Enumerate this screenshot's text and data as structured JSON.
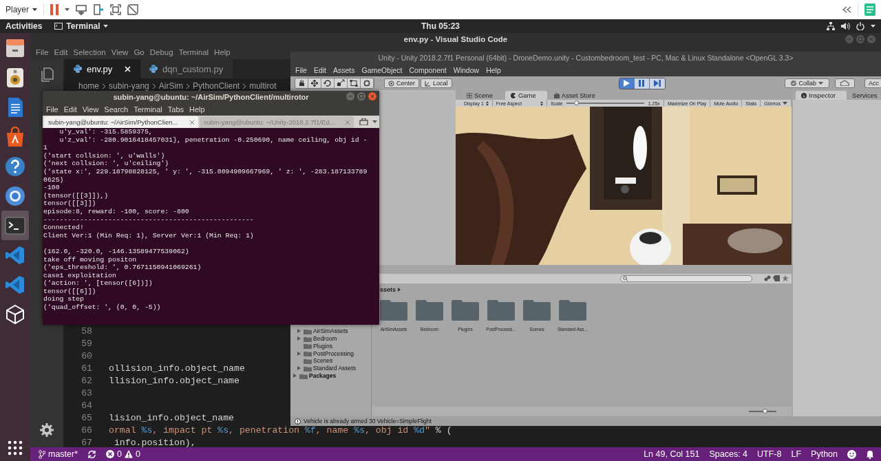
{
  "player_bar": {
    "menu": "Player"
  },
  "top_panel": {
    "activities": "Activities",
    "app_menu": "Terminal",
    "clock": "Thu 05:23"
  },
  "dock": [
    {
      "kind": "files",
      "active": false
    },
    {
      "kind": "music",
      "active": false
    },
    {
      "kind": "writer",
      "active": false
    },
    {
      "kind": "software",
      "active": false
    },
    {
      "kind": "help",
      "active": false
    },
    {
      "kind": "browser",
      "active": false
    },
    {
      "kind": "terminal",
      "active": true
    },
    {
      "kind": "code",
      "active": false
    },
    {
      "kind": "code",
      "active": false
    },
    {
      "kind": "unity",
      "active": false
    }
  ],
  "vscode": {
    "title": "env.py - Visual Studio Code",
    "menu": [
      "File",
      "Edit",
      "Selection",
      "View",
      "Go",
      "Debug",
      "Terminal",
      "Help"
    ],
    "tabs": [
      {
        "label": "env.py",
        "selected": true
      },
      {
        "label": "dqn_custom.py",
        "selected": false
      }
    ],
    "breadcrumb": [
      "home",
      "subin-yang",
      "AirSim",
      "PythonClient",
      "multirot"
    ],
    "code_lines": [
      {
        "number": "58"
      },
      {
        "number": "59"
      },
      {
        "number": "60"
      },
      {
        "number": "61",
        "tokens": [
          {
            "text": "ollision_info.object_name",
            "kind": "plain"
          }
        ]
      },
      {
        "number": "62",
        "tokens": [
          {
            "text": "llision_info.object_name",
            "kind": "plain"
          }
        ]
      },
      {
        "number": "63"
      },
      {
        "number": "64"
      },
      {
        "number": "65",
        "tokens": [
          {
            "text": "lision_info.object_name",
            "kind": "plain"
          }
        ]
      },
      {
        "number": "66",
        "tokens": [
          {
            "text": "ormal ",
            "kind": "string"
          },
          {
            "text": "%s",
            "kind": "format"
          },
          {
            "text": ", impact pt ",
            "kind": "string"
          },
          {
            "text": "%s",
            "kind": "format"
          },
          {
            "text": ", penetration ",
            "kind": "string"
          },
          {
            "text": "%f",
            "kind": "format"
          },
          {
            "text": ", name ",
            "kind": "string"
          },
          {
            "text": "%s",
            "kind": "format"
          },
          {
            "text": ", obj id ",
            "kind": "string"
          },
          {
            "text": "%d",
            "kind": "format"
          },
          {
            "text": "\"",
            "kind": "string"
          },
          {
            "text": " % (",
            "kind": "plain"
          }
        ]
      },
      {
        "number": "67",
        "tokens": [
          {
            "text": " info.position),",
            "kind": "plain"
          }
        ]
      }
    ],
    "status_bar": {
      "branch": "master*",
      "errors": "0",
      "warnings": "0",
      "position": "Ln 49, Col 151",
      "indent": "Spaces: 4",
      "encoding": "UTF-8",
      "eol": "LF",
      "language": "Python"
    }
  },
  "unity": {
    "title": "Unity - Unity 2018.2.7f1 Personal (64bit) - DroneDemo.unity - Custombedroom_test - PC, Mac & Linux Standalone <OpenGL 3.3>",
    "menu": [
      "File",
      "Edit",
      "Assets",
      "GameObject",
      "Component",
      "Window",
      "Help"
    ],
    "pivot": [
      "Center",
      "Local"
    ],
    "playing": true,
    "collab": "Collab",
    "account": "Acc",
    "view_tabs": [
      {
        "label": "Scene",
        "selected": false
      },
      {
        "label": "Game",
        "selected": true
      },
      {
        "label": "Asset Store",
        "selected": false
      }
    ],
    "game_toolbar": {
      "display": "Display 1",
      "aspect": "Free Aspect",
      "scale": {
        "label": "Scale",
        "level": 0.13,
        "value": "1.25x"
      },
      "buttons": [
        {
          "label": "Maximize On Play",
          "kind": "toggle"
        },
        {
          "label": "Mute Audio",
          "kind": "toggle"
        },
        {
          "label": "Stats",
          "kind": "toggle"
        },
        {
          "label": "Gizmos",
          "kind": "dropdown"
        }
      ]
    },
    "game_view": {
      "kind": "picture"
    },
    "inspector_tabs": [
      {
        "label": "Inspector",
        "selected": true
      },
      {
        "label": "Services",
        "selected": false
      }
    ],
    "project": {
      "breadcrumb": "ssets",
      "tree": [
        {
          "label": "AirSimAssets",
          "expandable": true
        },
        {
          "label": "Bedroom",
          "expandable": true
        },
        {
          "label": "Plugins",
          "expandable": false
        },
        {
          "label": "PostProcessing",
          "expandable": true
        },
        {
          "label": "Scenes",
          "expandable": false
        },
        {
          "label": "Standard Assets",
          "expandable": true
        }
      ],
      "packages": {
        "label": "Packages",
        "expandable": true
      },
      "grid": [
        "AirSimAssets",
        "Bedroom",
        "Plugins",
        "PostProcessi...",
        "Scenes",
        "Standard Ass..."
      ],
      "icon_size": {
        "level": 0.6
      }
    },
    "status": "Vehicle is already armed 30 Vehicle=SimpleFlight"
  },
  "terminal": {
    "title": "subin-yang@ubuntu: ~/AirSim/PythonClient/multirotor",
    "menu": [
      "File",
      "Edit",
      "View",
      "Search",
      "Terminal",
      "Tabs",
      "Help"
    ],
    "tabs": [
      {
        "label": "subin-yang@ubuntu: ~/AirSim/PythonClien...",
        "selected": true
      },
      {
        "label": "subin-yang@ubuntu: ~/Unity-2018.2.7f1/Ed...",
        "selected": false
      }
    ],
    "output": [
      {
        "lines": [
          "    u'y_val': -315.5859375,",
          "    u'z_val': -280.9016418457031}, penetration -0.250690, name ceiling, obj id -",
          "1",
          "('start collsion: ', u'walls')",
          "('next collsion: ', u'ceiling')",
          "('state x:', 229.18798828125, ' y: ', -315.0094909667969, ' z: ', -283.187133789",
          "0625)",
          "-100",
          "(tensor([[3]]),)",
          "tensor([[3]])",
          "episode:8, reward: -100, score: -800",
          "----------------------------------------------------",
          "Connected!",
          "Client Ver:1 (Min Req: 1), Server Ver:1 (Min Req: 1)"
        ]
      },
      {
        "lines": [
          "(162.0, -320.0, -146.13589477539062)",
          "take off moving positon",
          "('eps_threshold: ', 0.7671150941069261)",
          "case1 exploitation",
          "('action: ', [tensor([6])])",
          "tensor([[6]])",
          "doing step",
          "('quad_offset: ', (0, 0, -5))"
        ]
      }
    ]
  }
}
